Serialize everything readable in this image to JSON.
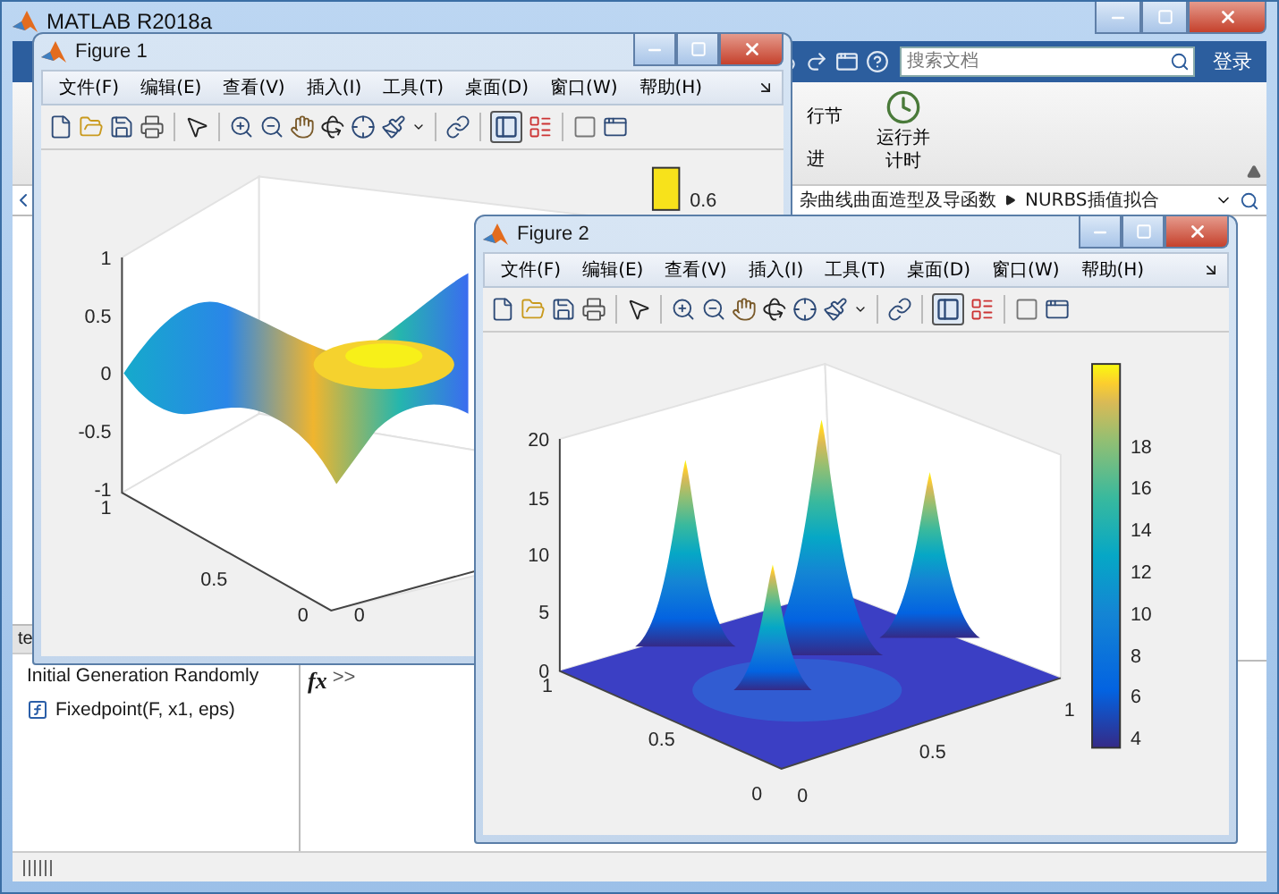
{
  "main_window": {
    "title": "MATLAB R2018a",
    "search": {
      "placeholder": "搜索文档"
    },
    "login": "登录",
    "ribbon": [
      {
        "label": "行节",
        "kind": "small"
      },
      {
        "label": "进",
        "kind": "small"
      },
      {
        "label": "运行并计时",
        "kind": "large"
      }
    ],
    "address_path": [
      "杂曲线曲面造型及导函数",
      "NURBS插值拟合"
    ],
    "details": {
      "header": "te",
      "items": [
        {
          "label": "Initial Generation Randomly",
          "kind": "text"
        },
        {
          "label": "Fixedpoint(F, x1, eps)",
          "kind": "function"
        }
      ]
    },
    "command_window": {
      "fx": "fx",
      "prompt": ">>"
    }
  },
  "figures": [
    {
      "title": "Figure 1",
      "kind": "wave",
      "colorbar_button_pressed": true,
      "menus": [
        "文件(F)",
        "编辑(E)",
        "查看(V)",
        "插入(I)",
        "工具(T)",
        "桌面(D)",
        "窗口(W)",
        "帮助(H)"
      ],
      "z_ticks": [
        "1",
        "0.5",
        "0",
        "-0.5",
        "-1"
      ],
      "y_ticks": [
        "1",
        "0.5",
        "0"
      ],
      "x_ticks": [
        "0"
      ],
      "colorbar_ticks": [
        "0.6"
      ]
    },
    {
      "title": "Figure 2",
      "kind": "peaks",
      "colorbar_button_pressed": true,
      "menus": [
        "文件(F)",
        "编辑(E)",
        "查看(V)",
        "插入(I)",
        "工具(T)",
        "桌面(D)",
        "窗口(W)",
        "帮助(H)"
      ],
      "z_ticks": [
        "20",
        "15",
        "10",
        "5",
        "0"
      ],
      "y_ticks": [
        "1",
        "0.5",
        "0"
      ],
      "x_ticks": [
        "0",
        "0.5",
        "1"
      ],
      "colorbar_ticks": [
        "18",
        "16",
        "14",
        "12",
        "10",
        "8",
        "6",
        "4"
      ]
    }
  ]
}
